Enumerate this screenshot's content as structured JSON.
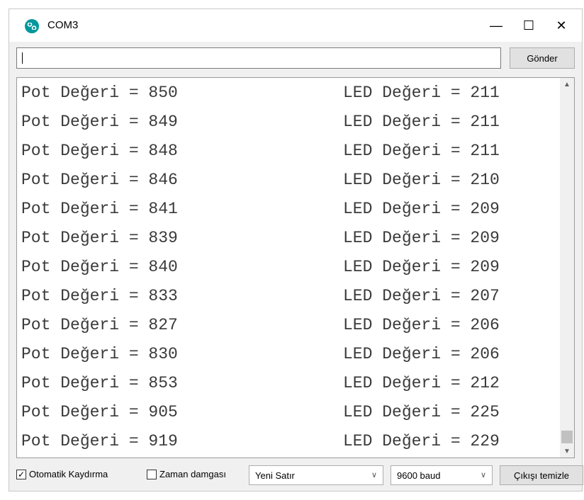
{
  "window": {
    "title": "COM3",
    "minimize_glyph": "—",
    "maximize_glyph": "☐",
    "close_glyph": "✕"
  },
  "input": {
    "value": "",
    "send_label": "Gönder"
  },
  "output": {
    "lines": [
      {
        "pot": "Pot Değeri = 850",
        "led": "LED Değeri = 211"
      },
      {
        "pot": "Pot Değeri = 849",
        "led": "LED Değeri = 211"
      },
      {
        "pot": "Pot Değeri = 848",
        "led": "LED Değeri = 211"
      },
      {
        "pot": "Pot Değeri = 846",
        "led": "LED Değeri = 210"
      },
      {
        "pot": "Pot Değeri = 841",
        "led": "LED Değeri = 209"
      },
      {
        "pot": "Pot Değeri = 839",
        "led": "LED Değeri = 209"
      },
      {
        "pot": "Pot Değeri = 840",
        "led": "LED Değeri = 209"
      },
      {
        "pot": "Pot Değeri = 833",
        "led": "LED Değeri = 207"
      },
      {
        "pot": "Pot Değeri = 827",
        "led": "LED Değeri = 206"
      },
      {
        "pot": "Pot Değeri = 830",
        "led": "LED Değeri = 206"
      },
      {
        "pot": "Pot Değeri = 853",
        "led": "LED Değeri = 212"
      },
      {
        "pot": "Pot Değeri = 905",
        "led": "LED Değeri = 225"
      },
      {
        "pot": "Pot Değeri = 919",
        "led": "LED Değeri = 229"
      }
    ]
  },
  "statusbar": {
    "autoscroll_label": "Otomatik Kaydırma",
    "autoscroll_checked": true,
    "timestamp_label": "Zaman damgası",
    "timestamp_checked": false,
    "line_ending": "Yeni Satır",
    "baud": "9600 baud",
    "clear_label": "Çıkışı temizle"
  },
  "colors": {
    "app_icon": "#00979d",
    "output_text": "#3a3a3a"
  }
}
